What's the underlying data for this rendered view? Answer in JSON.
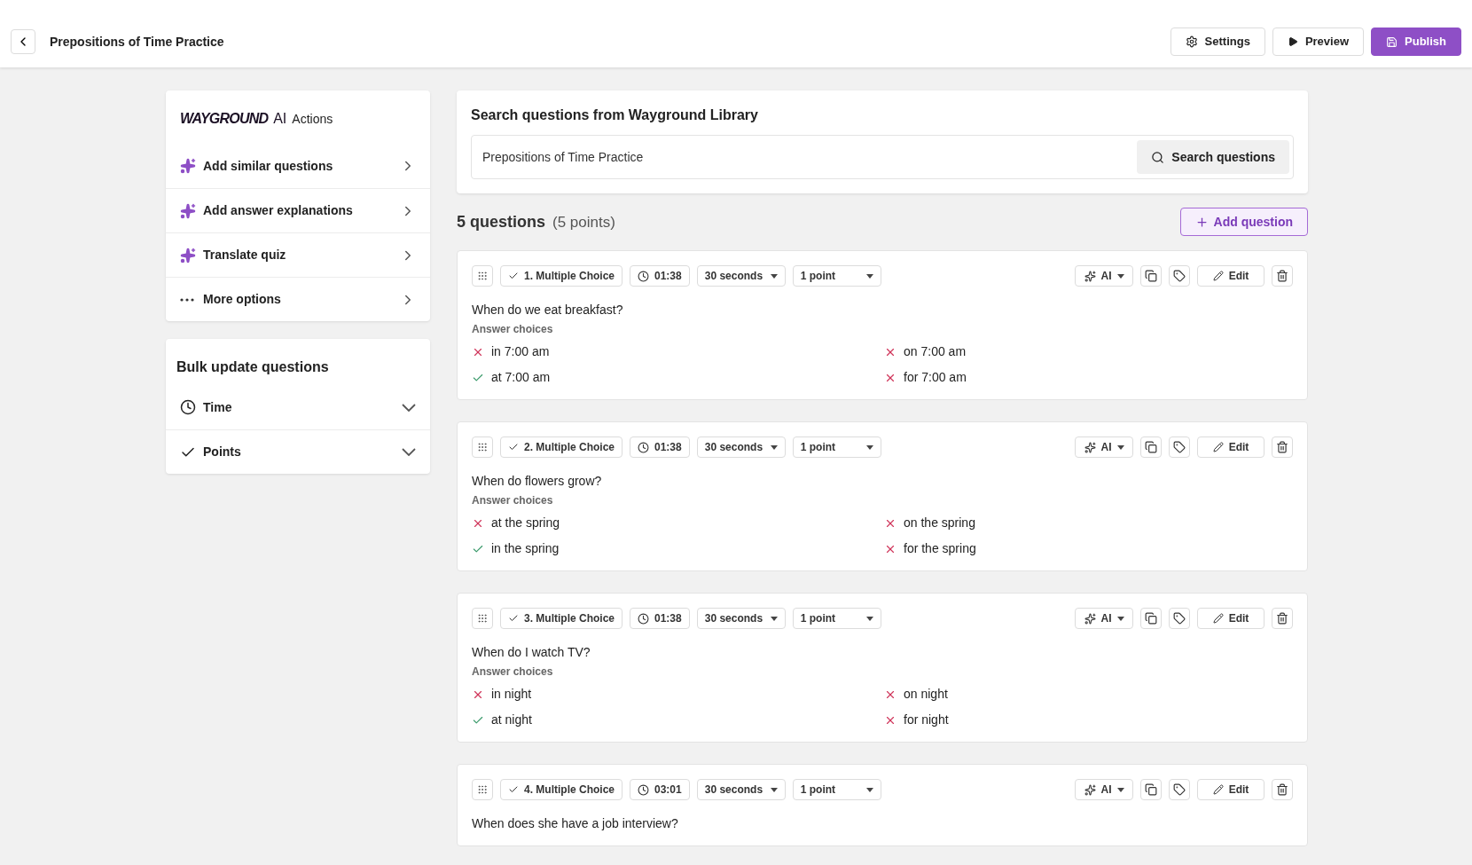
{
  "header": {
    "title": "Prepositions of Time Practice",
    "buttons": [
      {
        "label": "Settings",
        "kind": "settings"
      },
      {
        "label": "Preview",
        "kind": "preview"
      },
      {
        "label": "Publish",
        "kind": "publish"
      }
    ]
  },
  "ai_panel": {
    "brand": "WAYGROUND",
    "brand_suffix": "AI",
    "title": "Actions",
    "items": [
      {
        "label": "Add similar questions",
        "kind": "ai"
      },
      {
        "label": "Add answer explanations",
        "kind": "ai"
      },
      {
        "label": "Translate quiz",
        "kind": "ai"
      },
      {
        "label": "More options",
        "kind": "more"
      }
    ]
  },
  "bulk_panel": {
    "title": "Bulk update questions",
    "items": [
      {
        "label": "Time",
        "kind": "time",
        "expanded": false
      },
      {
        "label": "Points",
        "kind": "points",
        "expanded": false
      }
    ]
  },
  "library": {
    "title": "Search questions from Wayground Library",
    "search": {
      "value": "Prepositions of Time Practice"
    },
    "button": "Search questions"
  },
  "summary": {
    "count": "5 questions",
    "points": "(5 points)",
    "add_button": "Add question"
  },
  "questions": [
    {
      "type": "1. Multiple Choice",
      "duration": "01:38",
      "time_limit": "30 seconds",
      "points": "1 point",
      "ai": "AI",
      "edit": "Edit",
      "text": "When do we eat breakfast?",
      "choices_label": "Answer choices",
      "choices": [
        {
          "text": "in 7:00 am",
          "correct": false
        },
        {
          "text": "on 7:00 am",
          "correct": false
        },
        {
          "text": "at 7:00 am",
          "correct": true
        },
        {
          "text": "for 7:00 am",
          "correct": false
        }
      ]
    },
    {
      "type": "2. Multiple Choice",
      "duration": "01:38",
      "time_limit": "30 seconds",
      "points": "1 point",
      "ai": "AI",
      "edit": "Edit",
      "text": "When do flowers grow?",
      "choices_label": "Answer choices",
      "choices": [
        {
          "text": "at the spring",
          "correct": false
        },
        {
          "text": "on the spring",
          "correct": false
        },
        {
          "text": "in the spring",
          "correct": true
        },
        {
          "text": "for the spring",
          "correct": false
        }
      ]
    },
    {
      "type": "3. Multiple Choice",
      "duration": "01:38",
      "time_limit": "30 seconds",
      "points": "1 point",
      "ai": "AI",
      "edit": "Edit",
      "text": "When do I watch TV?",
      "choices_label": "Answer choices",
      "choices": [
        {
          "text": "in night",
          "correct": false
        },
        {
          "text": "on night",
          "correct": false
        },
        {
          "text": "at night",
          "correct": true
        },
        {
          "text": "for night",
          "correct": false
        }
      ]
    },
    {
      "type": "4. Multiple Choice",
      "duration": "03:01",
      "time_limit": "30 seconds",
      "points": "1 point",
      "ai": "AI",
      "edit": "Edit",
      "text": "When does she have a job interview?"
    }
  ]
}
